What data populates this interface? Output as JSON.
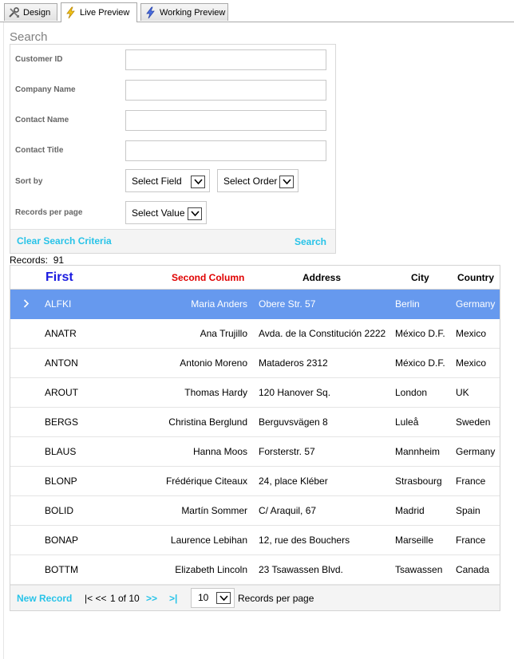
{
  "tabs": [
    {
      "label": "Design",
      "icon": "tools-icon"
    },
    {
      "label": "Live Preview",
      "icon": "lightning-icon"
    },
    {
      "label": "Working Preview",
      "icon": "lightning-icon"
    }
  ],
  "search": {
    "title": "Search",
    "fields": {
      "customer_id": {
        "label": "Customer ID",
        "value": ""
      },
      "company_name": {
        "label": "Company Name",
        "value": ""
      },
      "contact_name": {
        "label": "Contact Name",
        "value": ""
      },
      "contact_title": {
        "label": "Contact Title",
        "value": ""
      }
    },
    "sort_by": {
      "label": "Sort by",
      "field_value": "Select Field",
      "order_value": "Select Order"
    },
    "records_per_page": {
      "label": "Records per page",
      "value": "Select Value"
    },
    "clear_label": "Clear Search Criteria",
    "search_label": "Search"
  },
  "records": {
    "label": "Records:",
    "count": "91"
  },
  "grid": {
    "headers": {
      "first": "First",
      "second": "Second Column",
      "address": "Address",
      "city": "City",
      "country": "Country"
    },
    "header_colors": {
      "first": "#1a1ae0",
      "second": "#e00000"
    },
    "selected_row_color": "#6699ee",
    "rows": [
      {
        "id": "ALFKI",
        "name": "Maria Anders",
        "address": "Obere Str. 57",
        "city": "Berlin",
        "country": "Germany"
      },
      {
        "id": "ANATR",
        "name": "Ana Trujillo",
        "address": "Avda. de la Constitución 2222",
        "city": "México D.F.",
        "country": "Mexico"
      },
      {
        "id": "ANTON",
        "name": "Antonio Moreno",
        "address": "Mataderos 2312",
        "city": "México D.F.",
        "country": "Mexico"
      },
      {
        "id": "AROUT",
        "name": "Thomas Hardy",
        "address": "120 Hanover Sq.",
        "city": "London",
        "country": "UK"
      },
      {
        "id": "BERGS",
        "name": "Christina Berglund",
        "address": "Berguvsvägen 8",
        "city": "Luleå",
        "country": "Sweden"
      },
      {
        "id": "BLAUS",
        "name": "Hanna Moos",
        "address": "Forsterstr. 57",
        "city": "Mannheim",
        "country": "Germany"
      },
      {
        "id": "BLONP",
        "name": "Frédérique Citeaux",
        "address": "24, place Kléber",
        "city": "Strasbourg",
        "country": "France"
      },
      {
        "id": "BOLID",
        "name": "Martín Sommer",
        "address": "C/ Araquil, 67",
        "city": "Madrid",
        "country": "Spain"
      },
      {
        "id": "BONAP",
        "name": "Laurence Lebihan",
        "address": "12, rue des Bouchers",
        "city": "Marseille",
        "country": "France"
      },
      {
        "id": "BOTTM",
        "name": "Elizabeth Lincoln",
        "address": "23 Tsawassen Blvd.",
        "city": "Tsawassen",
        "country": "Canada"
      }
    ]
  },
  "footer": {
    "new_record": "New Record",
    "first_prev": "|< <<",
    "page_info": "1 of 10",
    "next": ">>",
    "last": ">|",
    "per_page_value": "10",
    "per_page_label": "Records per page"
  }
}
